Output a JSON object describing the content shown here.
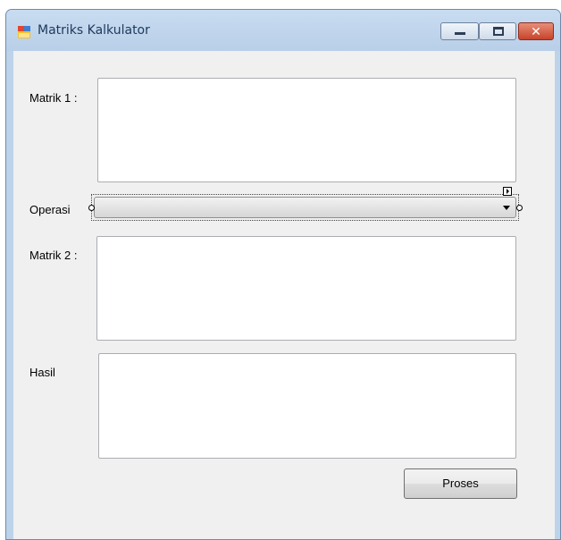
{
  "window": {
    "title": "Matriks Kalkulator"
  },
  "form": {
    "matrix1_label": "Matrik 1 :",
    "operation_label": "Operasi",
    "operation_value": "",
    "matrix2_label": "Matrik 2 :",
    "result_label": "Hasil",
    "matrix1_value": "",
    "matrix2_value": "",
    "result_value": "",
    "process_button": "Proses"
  },
  "colors": {
    "frame": "#bcd3ea",
    "client": "#f0f0f0",
    "close_button": "#c7432b"
  }
}
